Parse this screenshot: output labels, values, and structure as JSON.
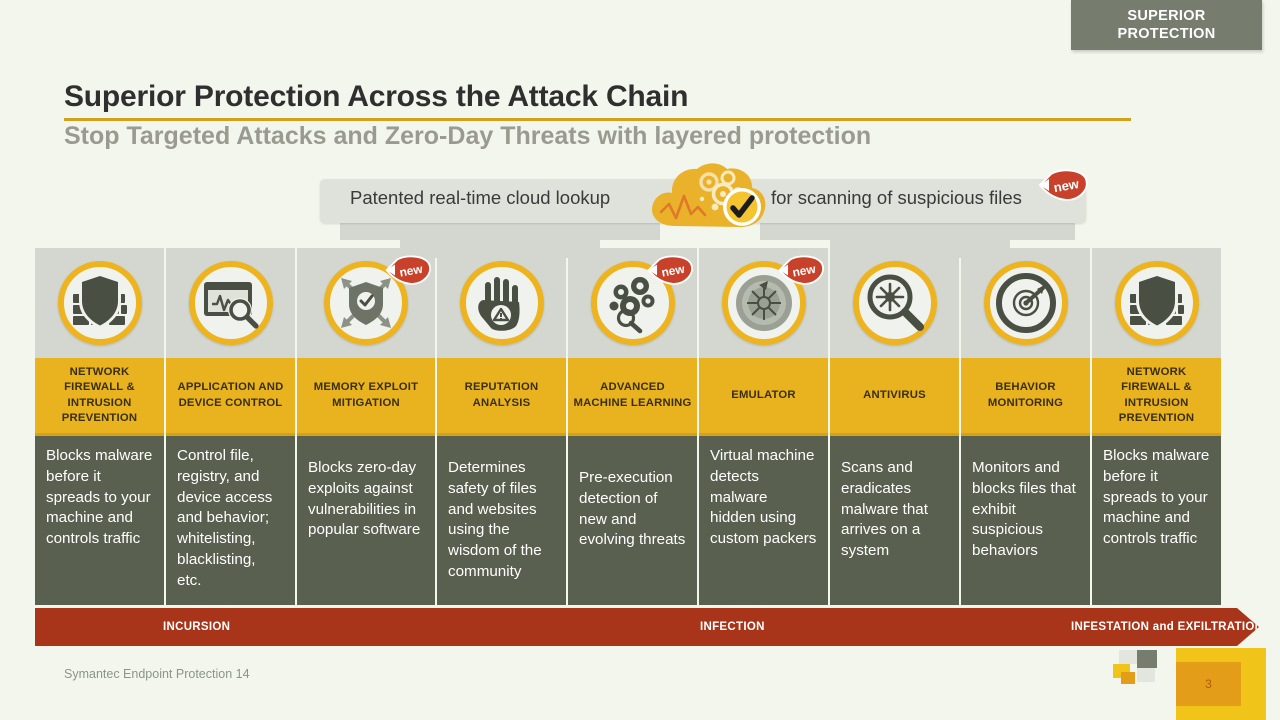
{
  "corner_banner": {
    "line1": "SUPERIOR",
    "line2": "PROTECTION"
  },
  "header": {
    "title": "Superior Protection Across the Attack Chain",
    "subtitle": "Stop Targeted Attacks and Zero-Day Threats with layered protection",
    "rule_color": "#d3a21c"
  },
  "cloud_banner": {
    "text_left": "Patented real-time cloud lookup",
    "text_right": "for scanning of suspicious files",
    "badge": "new",
    "icon": "cloud-gears-checkmark-icon",
    "background": "#dfe2da"
  },
  "columns": [
    {
      "icon": "firewall-shield-brick-icon",
      "label": "NETWORK FIREWALL & INTRUSION PREVENTION",
      "description": "Blocks malware before it spreads to your machine and controls traffic",
      "badge": null,
      "desc_offset": "top"
    },
    {
      "icon": "application-window-monitor-magnifier-icon",
      "label": "APPLICATION AND DEVICE CONTROL",
      "description": "Control file, registry, and device access and behavior; whitelisting, blacklisting, etc.",
      "badge": null,
      "desc_offset": "top"
    },
    {
      "icon": "memory-exploit-shield-arrows-icon",
      "label": "MEMORY EXPLOIT MITIGATION",
      "description": "Blocks zero-day exploits against vulnerabilities in popular software",
      "badge": "new",
      "desc_offset": "mid"
    },
    {
      "icon": "reputation-hand-stop-icon",
      "label": "REPUTATION ANALYSIS",
      "description": "Determines safety of files and websites using the wisdom of the community",
      "badge": null,
      "desc_offset": "mid"
    },
    {
      "icon": "machine-learning-gears-brain-icon",
      "label": "ADVANCED MACHINE LEARNING",
      "description": "Pre-execution detection of new and evolving threats",
      "badge": "new",
      "desc_offset": "low"
    },
    {
      "icon": "emulator-virtual-machine-icon",
      "label": "EMULATOR",
      "description": "Virtual machine detects malware hidden using custom packers",
      "badge": "new",
      "desc_offset": "top"
    },
    {
      "icon": "antivirus-magnifier-virus-icon",
      "label": "ANTIVIRUS",
      "description": "Scans and eradicates malware that arrives on a system",
      "badge": null,
      "desc_offset": "mid"
    },
    {
      "icon": "behavior-monitoring-radar-icon",
      "label": "BEHAVIOR MONITORING",
      "description": "Monitors and blocks files that exhibit suspicious behaviors",
      "badge": null,
      "desc_offset": "mid"
    },
    {
      "icon": "firewall-shield-brick-icon",
      "label": "NETWORK FIREWALL & INTRUSION PREVENTION",
      "description": "Blocks malware before it spreads to your machine and controls traffic",
      "badge": null,
      "desc_offset": "top"
    }
  ],
  "stages": [
    {
      "label": "INCURSION"
    },
    {
      "label": "INFECTION"
    },
    {
      "label": "INFESTATION and EXFILTRATION"
    }
  ],
  "footer": {
    "product": "Symantec Endpoint Protection 14",
    "page_number": "3"
  },
  "colors": {
    "background": "#f2f6ec",
    "label_yellow": "#e8b31e",
    "desc_gray": "#59604f",
    "icon_panel": "#d3d7d0",
    "stage_red": "#a8351a",
    "badge_red": "#c8412a",
    "corner_gray": "#767d6e"
  }
}
